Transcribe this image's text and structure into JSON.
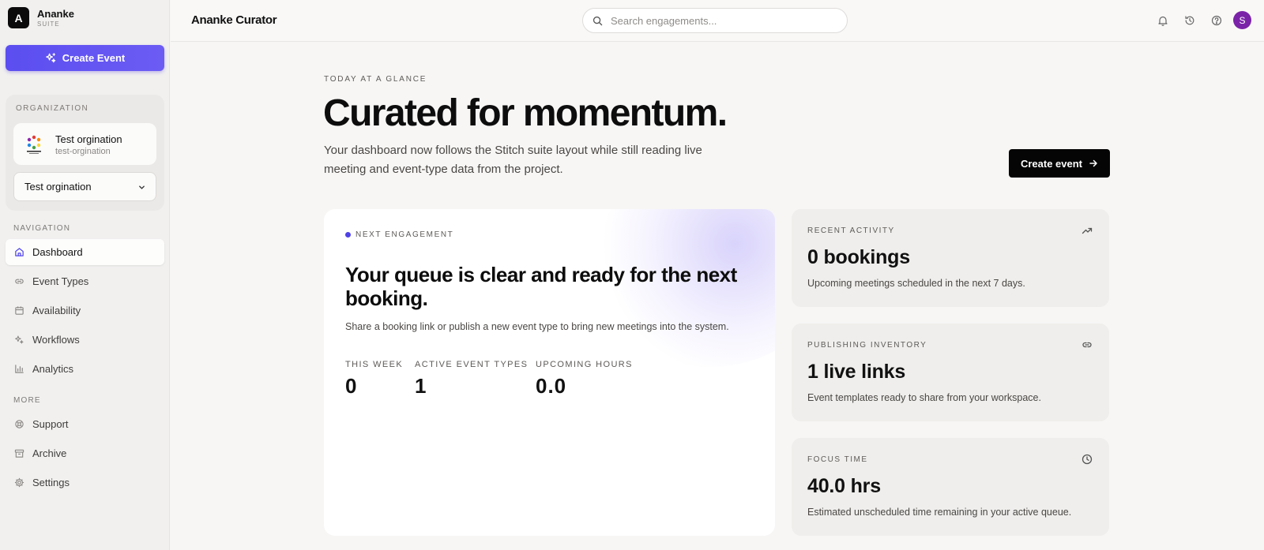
{
  "brand": {
    "logo_letter": "A",
    "name": "Ananke",
    "suite": "SUITE"
  },
  "sidebar": {
    "create_label": "Create Event",
    "organization": {
      "section_label": "ORGANIZATION",
      "name": "Test orgination",
      "slug": "test-orgination",
      "selected": "Test orgination"
    },
    "navigation_label": "NAVIGATION",
    "nav_items": [
      {
        "label": "Dashboard",
        "icon": "home-icon",
        "active": true
      },
      {
        "label": "Event Types",
        "icon": "link-icon"
      },
      {
        "label": "Availability",
        "icon": "calendar-icon"
      },
      {
        "label": "Workflows",
        "icon": "sparkles-icon"
      },
      {
        "label": "Analytics",
        "icon": "bar-chart-icon"
      }
    ],
    "more_label": "MORE",
    "more_items": [
      {
        "label": "Support",
        "icon": "lifebuoy-icon"
      },
      {
        "label": "Archive",
        "icon": "archive-icon"
      },
      {
        "label": "Settings",
        "icon": "gear-icon"
      }
    ]
  },
  "topbar": {
    "title": "Ananke Curator",
    "search_placeholder": "Search engagements...",
    "avatar_letter": "S"
  },
  "hero": {
    "eyebrow": "TODAY AT A GLANCE",
    "title": "Curated for momentum.",
    "subtitle": "Your dashboard now follows the Stitch suite layout while still reading live meeting and event-type data from the project.",
    "button_label": "Create event"
  },
  "next_engagement": {
    "label": "NEXT ENGAGEMENT",
    "title": "Your queue is clear and ready for the next booking.",
    "description": "Share a booking link or publish a new event type to bring new meetings into the system.",
    "stats": [
      {
        "label": "THIS WEEK",
        "value": "0"
      },
      {
        "label": "ACTIVE EVENT TYPES",
        "value": "1"
      },
      {
        "label": "UPCOMING HOURS",
        "value": "0.0"
      }
    ]
  },
  "side_cards": [
    {
      "label": "RECENT ACTIVITY",
      "icon": "trending-up-icon",
      "value": "0 bookings",
      "description": "Upcoming meetings scheduled in the next 7 days."
    },
    {
      "label": "PUBLISHING INVENTORY",
      "icon": "link-icon",
      "value": "1 live links",
      "description": "Event templates ready to share from your workspace."
    },
    {
      "label": "FOCUS TIME",
      "icon": "clock-icon",
      "value": "40.0 hrs",
      "description": "Estimated unscheduled time remaining in your active queue."
    }
  ],
  "colors": {
    "accent": "#5b4ef0",
    "avatar": "#7b23a8",
    "primary_button": "#050505"
  }
}
